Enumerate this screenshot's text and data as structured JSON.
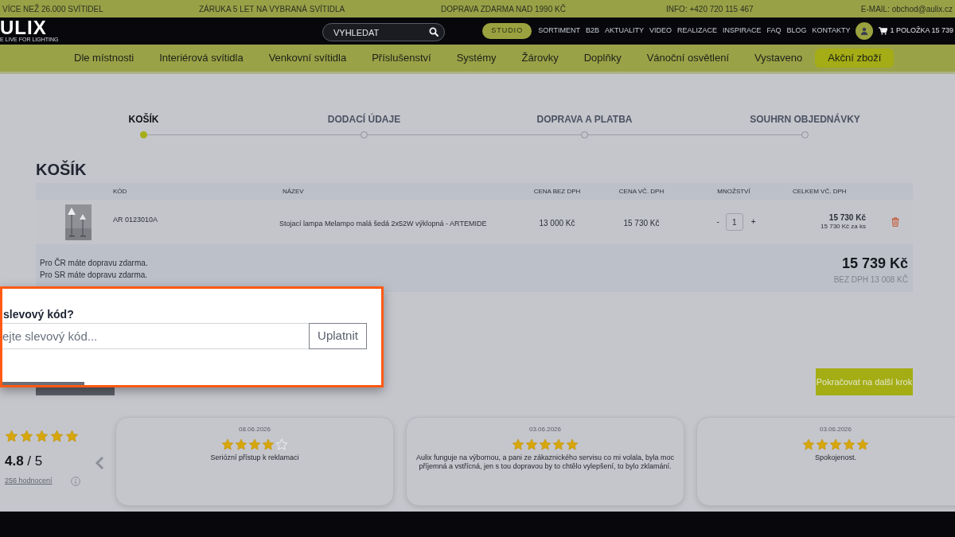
{
  "top_bar": {
    "items": [
      "VÍCE NEŽ 26.000 SVÍTIDEL",
      "ZÁRUKA 5 LET NA VYBRANÁ SVÍTIDLA",
      "DOPRAVA ZDARMA NAD 1990 KČ",
      "INFO: +420 720 115 467",
      "E-MAIL: obchod@aulix.cz"
    ]
  },
  "header": {
    "logo": "ULIX",
    "tagline": "E LIVE FOR LIGHTING",
    "search": {
      "placeholder": "VYHLEDAT"
    },
    "studio_button": "STUDIO",
    "links": [
      "SORTIMENT",
      "B2B",
      "AKTUALITY",
      "VIDEO",
      "REALIZACE",
      "INSPIRACE",
      "FAQ",
      "BLOG",
      "KONTAKTY"
    ],
    "cart": "1 POLOŽKA 15 739"
  },
  "categories": [
    {
      "label": "Dle místnosti",
      "selected": false
    },
    {
      "label": "Interiérová svítidla",
      "selected": false
    },
    {
      "label": "Venkovní svítidla",
      "selected": false
    },
    {
      "label": "Příslušenství",
      "selected": false
    },
    {
      "label": "Systémy",
      "selected": false
    },
    {
      "label": "Žárovky",
      "selected": false
    },
    {
      "label": "Doplňky",
      "selected": false
    },
    {
      "label": "Vánoční osvětlení",
      "selected": false
    },
    {
      "label": "Vystaveno",
      "selected": false
    },
    {
      "label": "Akční zboží",
      "selected": true
    }
  ],
  "steps": [
    {
      "label": "KOŠÍK",
      "selected": true
    },
    {
      "label": "DODACÍ ÚDAJE",
      "selected": false
    },
    {
      "label": "DOPRAVA A PLATBA",
      "selected": false
    },
    {
      "label": "SOUHRN OBJEDNÁVKY",
      "selected": false
    }
  ],
  "cart": {
    "title": "KOŠÍK",
    "columns": [
      "KÓD",
      "NÁZEV",
      "CENA BEZ DPH",
      "CENA VČ. DPH",
      "MNOŽSTVÍ",
      "CELKEM VČ. DPH"
    ],
    "rows": [
      {
        "code": "AR 0123010A",
        "name": "Stojací lampa Melampo malá šedá 2x52W výklopná - ARTEMIDE",
        "price_excl_vat": "13 000 Kč",
        "price_incl_vat": "15 730 Kč",
        "decrease": "-",
        "quantity": "1",
        "increase": "+",
        "total": "15 730 Kč",
        "unit_price": "15 730 Kč za ks"
      }
    ],
    "notes": [
      "Pro ČR máte dopravu zdarma.",
      "Pro SR máte dopravu zdarma."
    ],
    "total": "15 739 Kč",
    "total_excl_vat": "BEZ DPH 13 008 KČ",
    "continue_button": "Pokračovat na další krok"
  },
  "coupon_popup": {
    "title": "slevový kód?",
    "placeholder": "ejte slevový kód...",
    "button": "Uplatnit"
  },
  "reviews": {
    "summary": {
      "stars": 5,
      "score": "**4.8** / 5",
      "count": "256 hodnocení"
    },
    "items": [
      {
        "date": "08.06.2026",
        "stars": 4,
        "text": "Seriózní přístup k reklamaci"
      },
      {
        "date": "03.06.2026",
        "stars": 5,
        "text": "Aulix funguje na výbornou, a pani ze zákaznického servisu co mi volala, byla moc příjemná a vstřícná, jen s tou dopravou by to chtělo vylepšení, to bylo zklamání."
      },
      {
        "date": "03.06.2026",
        "stars": 5,
        "text": "Spokojenost."
      }
    ]
  }
}
